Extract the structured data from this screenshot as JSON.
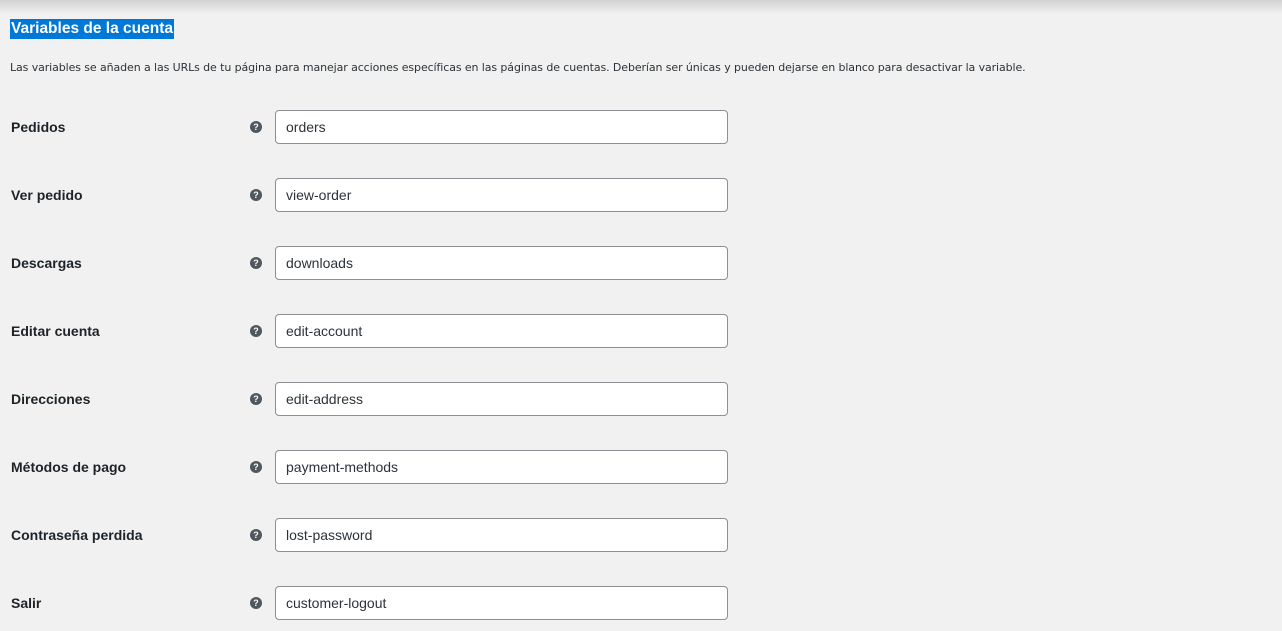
{
  "section": {
    "title": "Variables de la cuenta",
    "description": "Las variables se añaden a las URLs de tu página para manejar acciones específicas en las páginas de cuentas. Deberían ser únicas y pueden dejarse en blanco para desactivar la variable."
  },
  "help_icon": {
    "name": "question-circle-icon",
    "glyph": "?"
  },
  "fields": [
    {
      "label": "Pedidos",
      "value": "orders"
    },
    {
      "label": "Ver pedido",
      "value": "view-order"
    },
    {
      "label": "Descargas",
      "value": "downloads"
    },
    {
      "label": "Editar cuenta",
      "value": "edit-account"
    },
    {
      "label": "Direcciones",
      "value": "edit-address"
    },
    {
      "label": "Métodos de pago",
      "value": "payment-methods"
    },
    {
      "label": "Contraseña perdida",
      "value": "lost-password"
    },
    {
      "label": "Salir",
      "value": "customer-logout"
    }
  ],
  "colors": {
    "page_background": "#f1f1f1",
    "title_highlight": "#0078d7",
    "input_border": "#8c8f94",
    "help_icon": "#50575e"
  }
}
